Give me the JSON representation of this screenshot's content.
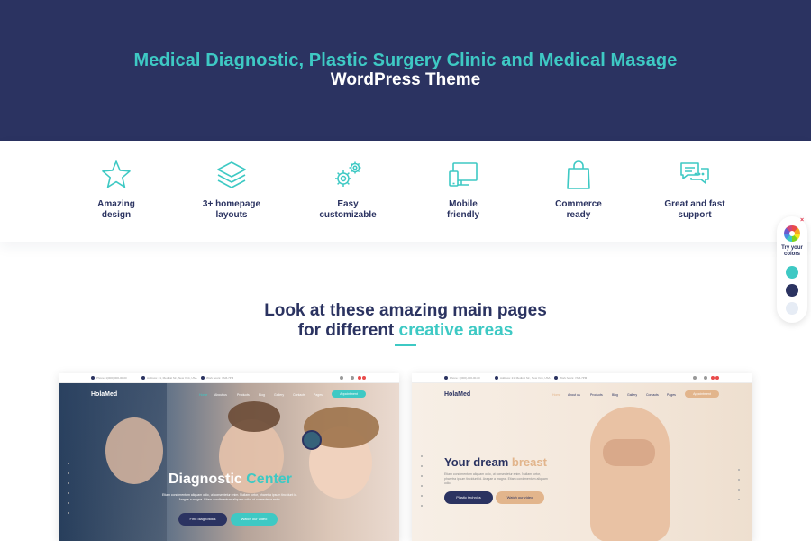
{
  "hero": {
    "line1": "Medical Diagnostic, Plastic Surgery Clinic and Medical Masage",
    "line2": "WordPress Theme"
  },
  "features": [
    {
      "icon": "star-icon",
      "label": "Amazing\ndesign"
    },
    {
      "icon": "layers-icon",
      "label": "3+ homepage\nlayouts"
    },
    {
      "icon": "gears-icon",
      "label": "Easy\ncustomizable"
    },
    {
      "icon": "devices-icon",
      "label": "Mobile\nfriendly"
    },
    {
      "icon": "shopping-bag-icon",
      "label": "Commerce\nready"
    },
    {
      "icon": "chat-icon",
      "label": "Great and fast\nsupport"
    }
  ],
  "color_picker": {
    "close": "×",
    "label": "Try your\ncolors",
    "swatches": [
      "#3ec9c4",
      "#2b3361",
      "#e6ecf5"
    ]
  },
  "section": {
    "title_line1": "Look at these amazing main pages",
    "title_line2_plain": "for different ",
    "title_line2_accent": "creative areas"
  },
  "colors": {
    "navy": "#2b3361",
    "teal": "#3ec9c4",
    "beige_accent": "#e2b58c"
  },
  "demo_left": {
    "topbar": [
      "Phone: 1(000)-000-00-00",
      "Address: 21, Medical Str., New York, USA",
      "Work hours: 7AM-7PM"
    ],
    "logo": "HolaMed",
    "nav": [
      "Home",
      "About us",
      "Products",
      "Blog",
      "Gallery",
      "Contacts",
      "Pages"
    ],
    "cta": "Appointment",
    "title_plain": "Diagnostic ",
    "title_accent": "Center",
    "text": "Etiam condimentum aliquam odio, ut consectetur enim. Nullam tortor, pharetra ipsum tincidunt id. Aragae a magna. Etiam condimentum aliquam odio, ut consectetur enim.",
    "btn_primary": "Find diagnostics",
    "btn_secondary": "Watch our video"
  },
  "demo_right": {
    "topbar": [
      "Phone: 1(000)-000-00-00",
      "Address: 21, Medical Str., New York, USA",
      "Work hours: 7AM-7PM"
    ],
    "logo": "HolaMed",
    "nav": [
      "Home",
      "About us",
      "Products",
      "Blog",
      "Gallery",
      "Contacts",
      "Pages"
    ],
    "cta": "Appointment",
    "title_plain": "Your dream ",
    "title_accent": "breast",
    "text": "Etiam condimentum aliquam odio, ut consectetur enim. Nullam tortor, pharetra ipsum tincidunt id. Aragae a magna. Etiam condimentum aliquam odio.",
    "btn_primary": "Plastic techniks",
    "btn_secondary": "Watch our video"
  }
}
